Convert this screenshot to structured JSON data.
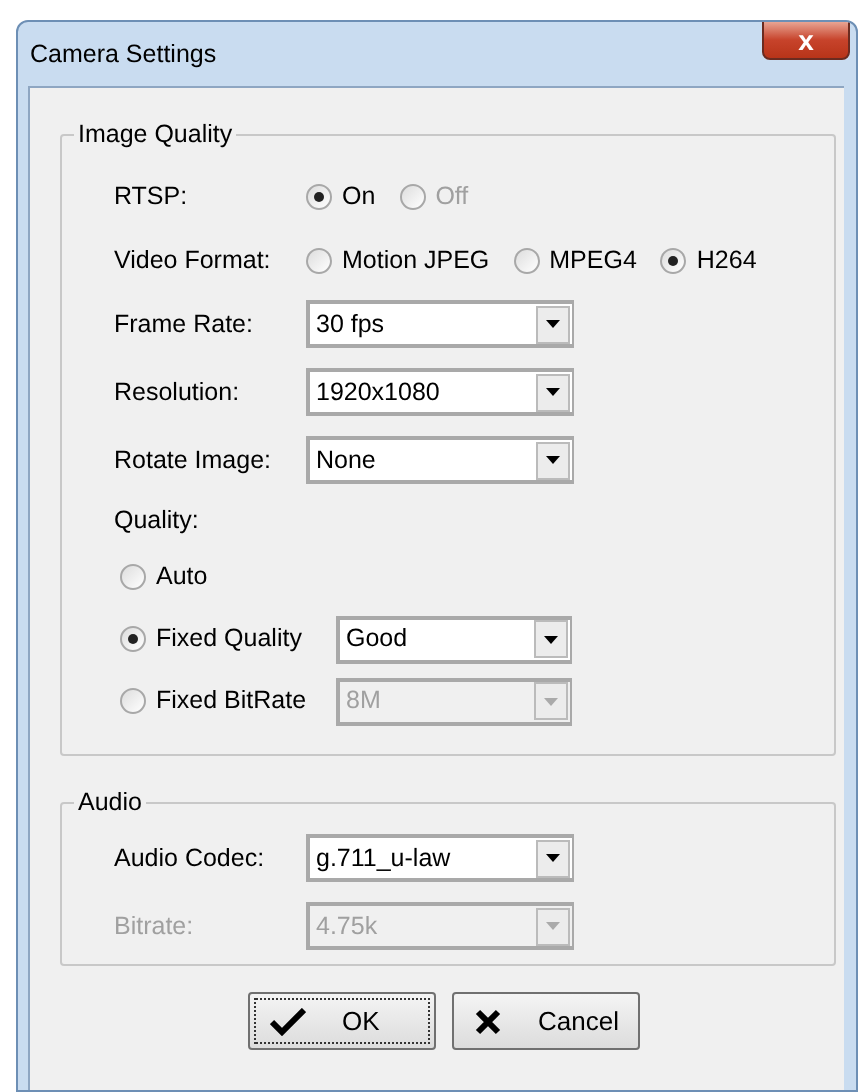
{
  "window": {
    "title": "Camera Settings",
    "close_icon": "x"
  },
  "groups": [
    {
      "title": "Image Quality",
      "rows": [
        {
          "kind": "radios",
          "label": "RTSP:",
          "options": [
            {
              "label": "On",
              "selected": true,
              "disabled": false
            },
            {
              "label": "Off",
              "selected": false,
              "disabled": true
            }
          ]
        },
        {
          "kind": "radios",
          "label": "Video Format:",
          "options": [
            {
              "label": "Motion JPEG",
              "selected": false,
              "disabled": false
            },
            {
              "label": "MPEG4",
              "selected": false,
              "disabled": false
            },
            {
              "label": "H264",
              "selected": true,
              "disabled": false
            }
          ]
        },
        {
          "kind": "select",
          "label": "Frame Rate:",
          "value": "30 fps",
          "disabled": false
        },
        {
          "kind": "select",
          "label": "Resolution:",
          "value": "1920x1080",
          "disabled": false
        },
        {
          "kind": "select",
          "label": "Rotate Image:",
          "value": "None",
          "disabled": false
        },
        {
          "kind": "caption",
          "label": "Quality:"
        },
        {
          "kind": "choice",
          "label": "Auto",
          "selected": false
        },
        {
          "kind": "choice",
          "label": "Fixed Quality",
          "selected": true,
          "value": "Good",
          "disabled": false
        },
        {
          "kind": "choice",
          "label": "Fixed BitRate",
          "selected": false,
          "value": "8M",
          "disabled": true
        }
      ]
    },
    {
      "title": "Audio",
      "rows": [
        {
          "kind": "select",
          "label": "Audio Codec:",
          "value": "g.711_u-law",
          "disabled": false
        },
        {
          "kind": "select",
          "label": "Bitrate:",
          "value": "4.75k",
          "disabled": true
        }
      ]
    }
  ],
  "buttons": [
    {
      "kind": "confirm",
      "label": "OK",
      "focused": true
    },
    {
      "kind": "dismiss",
      "label": "Cancel",
      "focused": false
    }
  ]
}
